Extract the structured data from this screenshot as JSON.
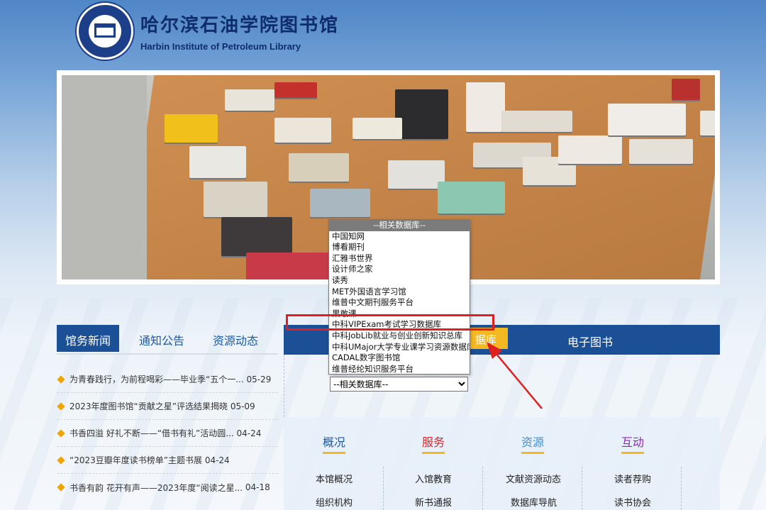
{
  "header": {
    "logo_cn": "哈尔滨石油学院图书馆",
    "logo_en": "Harbin Institute of Petroleum Library"
  },
  "news_tabs": [
    "馆务新闻",
    "通知公告",
    "资源动态"
  ],
  "news": [
    {
      "title": "为青春践行，为前程喝彩——毕业季“五个一...",
      "date": "05-29"
    },
    {
      "title": "2023年度图书馆“贡献之星”评选结果揭晓",
      "date": "05-09"
    },
    {
      "title": "书香四溢 好礼不断——“借书有礼”活动圆...",
      "date": "04-24"
    },
    {
      "title": "“2023豆瓣年度读书榜单”主题书展",
      "date": "04-24"
    },
    {
      "title": "书香有韵 花开有声——2023年度“阅读之星...",
      "date": "04-18"
    }
  ],
  "bluebar": {
    "active_tab_label": "据库",
    "ebook_label": "电子图书"
  },
  "database_select": {
    "selected": "--相关数据库--",
    "options": [
      "--相关数据库--",
      "中国知网",
      "博看期刊",
      "汇雅书世界",
      "设计师之家",
      "读秀",
      "MET外国语言学习馆",
      "维普中文期刊服务平台",
      "果敢课",
      "中科VIPExam考试学习数据库",
      "中科JobLib就业与创业创新知识总库",
      "中科UMajor大学专业课学习资源数据库",
      "CADAL数字图书馆",
      "维普经纶知识服务平台"
    ],
    "highlighted_option": "中科VIPExam考试学习数据库"
  },
  "services": {
    "columns": [
      {
        "title": "概况",
        "color": "#1c5aa8",
        "links": [
          "本馆概况",
          "组织机构"
        ]
      },
      {
        "title": "服务",
        "color": "#d8262b",
        "links": [
          "入馆教育",
          "新书通报"
        ]
      },
      {
        "title": "资源",
        "color": "#3f8fd8",
        "links": [
          "文献资源动态",
          "数据库导航"
        ]
      },
      {
        "title": "互动",
        "color": "#8a2bb8",
        "links": [
          "读者荐购",
          "读书协会"
        ]
      }
    ]
  },
  "colors": {
    "primary_blue": "#1b4f96",
    "accent_yellow": "#f5b820",
    "annotation_red": "#e02020"
  }
}
